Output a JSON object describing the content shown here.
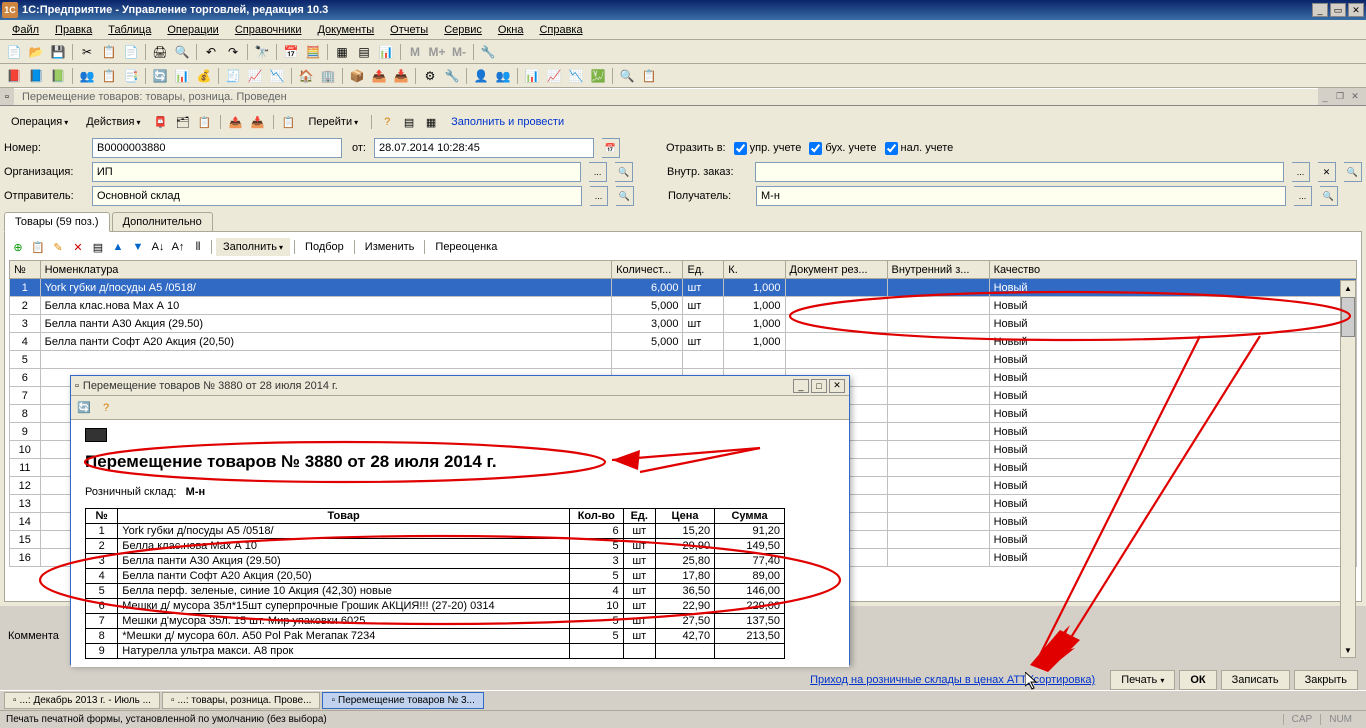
{
  "titlebar": {
    "app_icon": "1С",
    "title": "1С:Предприятие - Управление торговлей, редакция 10.3"
  },
  "menu": [
    "Файл",
    "Правка",
    "Таблица",
    "Операции",
    "Справочники",
    "Документы",
    "Отчеты",
    "Сервис",
    "Окна",
    "Справка"
  ],
  "doc_tab": {
    "title": "Перемещение товаров: товары, розница. Проведен"
  },
  "actions": {
    "operation": "Операция",
    "actions": "Действия",
    "goto": "Перейти",
    "fill_and_post": "Заполнить и провести"
  },
  "form": {
    "number_label": "Номер:",
    "number_value": "В0000003880",
    "from_label": "от:",
    "from_value": "28.07.2014 10:28:45",
    "reflect_label": "Отразить в:",
    "chk_upr": "упр. учете",
    "chk_buh": "бух. учете",
    "chk_nal": "нал. учете",
    "org_label": "Организация:",
    "org_value": "ИП",
    "int_order_label": "Внутр. заказ:",
    "int_order_value": "",
    "sender_label": "Отправитель:",
    "sender_value": "Основной склад",
    "recipient_label": "Получатель:",
    "recipient_value": "М-н"
  },
  "tabs": {
    "goods": "Товары (59 поз.)",
    "additional": "Дополнительно"
  },
  "grid_toolbar": {
    "fill": "Заполнить",
    "pick": "Подбор",
    "change": "Изменить",
    "revalue": "Переоценка"
  },
  "grid": {
    "cols": [
      "№",
      "Номенклатура",
      "Количест...",
      "Ед.",
      "К.",
      "Документ рез...",
      "Внутренний з...",
      "Качество"
    ],
    "rows": [
      {
        "n": "1",
        "name": "York губки д/посуды А5  /0518/",
        "qty": "6,000",
        "unit": "шт",
        "k": "1,000",
        "dr": "",
        "iz": "",
        "q": "Новый",
        "sel": true
      },
      {
        "n": "2",
        "name": "Белла клас.нова Мах А 10",
        "qty": "5,000",
        "unit": "шт",
        "k": "1,000",
        "dr": "",
        "iz": "",
        "q": "Новый"
      },
      {
        "n": "3",
        "name": "Белла панти А30 Акция (29.50)",
        "qty": "3,000",
        "unit": "шт",
        "k": "1,000",
        "dr": "",
        "iz": "",
        "q": "Новый"
      },
      {
        "n": "4",
        "name": "Белла панти Софт А20 Акция (20,50)",
        "qty": "5,000",
        "unit": "шт",
        "k": "1,000",
        "dr": "",
        "iz": "",
        "q": "Новый"
      },
      {
        "n": "5",
        "name": "",
        "qty": "",
        "unit": "",
        "k": "",
        "dr": "",
        "iz": "",
        "q": "Новый"
      },
      {
        "n": "6",
        "name": "",
        "qty": "",
        "unit": "",
        "k": "",
        "dr": "",
        "iz": "",
        "q": "Новый"
      },
      {
        "n": "7",
        "name": "",
        "qty": "",
        "unit": "",
        "k": "",
        "dr": "",
        "iz": "",
        "q": "Новый"
      },
      {
        "n": "8",
        "name": "",
        "qty": "",
        "unit": "",
        "k": "",
        "dr": "",
        "iz": "",
        "q": "Новый"
      },
      {
        "n": "9",
        "name": "",
        "qty": "",
        "unit": "",
        "k": "",
        "dr": "",
        "iz": "",
        "q": "Новый"
      },
      {
        "n": "10",
        "name": "",
        "qty": "",
        "unit": "",
        "k": "",
        "dr": "",
        "iz": "",
        "q": "Новый"
      },
      {
        "n": "11",
        "name": "",
        "qty": "",
        "unit": "",
        "k": "",
        "dr": "",
        "iz": "",
        "q": "Новый"
      },
      {
        "n": "12",
        "name": "",
        "qty": "",
        "unit": "",
        "k": "",
        "dr": "",
        "iz": "",
        "q": "Новый"
      },
      {
        "n": "13",
        "name": "",
        "qty": "",
        "unit": "",
        "k": "",
        "dr": "",
        "iz": "",
        "q": "Новый"
      },
      {
        "n": "14",
        "name": "",
        "qty": "",
        "unit": "",
        "k": "",
        "dr": "",
        "iz": "",
        "q": "Новый"
      },
      {
        "n": "15",
        "name": "",
        "qty": "",
        "unit": "",
        "k": "",
        "dr": "",
        "iz": "",
        "q": "Новый"
      },
      {
        "n": "16",
        "name": "",
        "qty": "",
        "unit": "",
        "k": "",
        "dr": "",
        "iz": "",
        "q": "Новый"
      }
    ]
  },
  "report": {
    "window_title": "Перемещение товаров № 3880 от 28 июля 2014 г.",
    "heading": "Перемещение товаров № 3880 от 28 июля 2014 г.",
    "retail_label": "Розничный склад:",
    "retail_value": "М-н",
    "cols": [
      "№",
      "Товар",
      "Кол-во",
      "Ед.",
      "Цена",
      "Сумма"
    ],
    "rows": [
      {
        "n": "1",
        "name": "York губки д/посуды А5  /0518/",
        "qty": "6",
        "unit": "шт",
        "price": "15,20",
        "sum": "91,20"
      },
      {
        "n": "2",
        "name": "Белла клас.нова Мах А 10",
        "qty": "5",
        "unit": "шт",
        "price": "29,90",
        "sum": "149,50"
      },
      {
        "n": "3",
        "name": "Белла панти А30 Акция (29.50)",
        "qty": "3",
        "unit": "шт",
        "price": "25,80",
        "sum": "77,40"
      },
      {
        "n": "4",
        "name": "Белла панти Софт А20 Акция (20,50)",
        "qty": "5",
        "unit": "шт",
        "price": "17,80",
        "sum": "89,00"
      },
      {
        "n": "5",
        "name": "Белла перф. зеленые, синие 10 Акция (42,30) новые",
        "qty": "4",
        "unit": "шт",
        "price": "36,50",
        "sum": "146,00"
      },
      {
        "n": "6",
        "name": "Мешки д/ мусора 35л*15шт суперпрочные Грошик АКЦИЯ!!! (27-20) 0314",
        "qty": "10",
        "unit": "шт",
        "price": "22,90",
        "sum": "229,00"
      },
      {
        "n": "7",
        "name": "Мешки д'мусора 35л. 15 шт. Мир упаковки 6025",
        "qty": "5",
        "unit": "шт",
        "price": "27,50",
        "sum": "137,50"
      },
      {
        "n": "8",
        "name": "*Мешки д/ мусора 60л. А50 Pol Pak Меrапак 7234",
        "qty": "5",
        "unit": "шт",
        "price": "42,70",
        "sum": "213,50"
      },
      {
        "n": "9",
        "name": "Натурелла ультра макси. А8 прок",
        "qty": "",
        "unit": "",
        "price": "",
        "sum": ""
      }
    ]
  },
  "comment_label": "Коммента",
  "footer": {
    "link": "Приход на розничные склады в ценах АТТ (сортировка)",
    "print": "Печать",
    "ok": "ОК",
    "save": "Записать",
    "close": "Закрыть"
  },
  "tasks": [
    "...: Декабрь 2013 г. - Июль ...",
    "...: товары, розница. Прове...",
    "Перемещение товаров № 3..."
  ],
  "statusbar": {
    "text": "Печать печатной формы, установленной по умолчанию (без выбора)",
    "cap": "CAP",
    "num": "NUM"
  }
}
